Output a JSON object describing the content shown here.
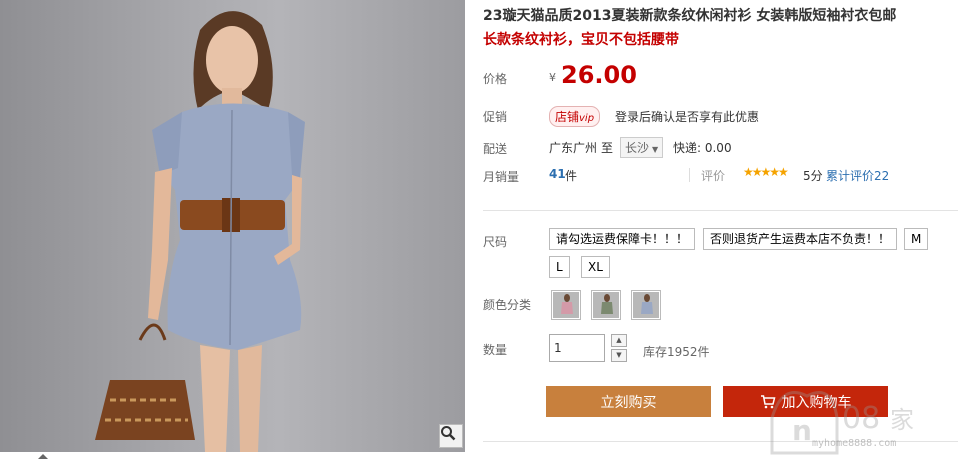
{
  "product": {
    "title_line1": "23璇天猫品质2013夏装新款条纹休闲衬衫 女装韩版短袖衬衣包邮",
    "title_line2": "长款条纹衬衫，宝贝不包括腰带"
  },
  "price": {
    "label": "价格",
    "symbol": "¥",
    "value": "26.00"
  },
  "promo": {
    "label": "促销",
    "tag": "店铺",
    "tag_vip": "vip",
    "text": "登录后确认是否享有此优惠"
  },
  "shipping": {
    "label": "配送",
    "from": "广东广州",
    "to_word": "至",
    "city": "长沙",
    "fee": "快递: 0.00"
  },
  "sales": {
    "label": "月销量",
    "count": "41",
    "unit": "件",
    "rating_label": "评价",
    "stars": "★★★★★",
    "score": "5分",
    "review_link": "累计评价22"
  },
  "size": {
    "label": "尺码",
    "options": [
      "请勾选运费保障卡！！！",
      "否则退货产生运费本店不负责！！",
      "M",
      "L",
      "XL"
    ]
  },
  "color": {
    "label": "颜色分类"
  },
  "quantity": {
    "label": "数量",
    "value": "1",
    "stock": "库存1952件"
  },
  "buttons": {
    "buy_now": "立刻购买",
    "add_cart": "加入购物车"
  },
  "watermark": {
    "text": "myhome8888.com"
  },
  "colors": {
    "price_red": "#c40000",
    "link_blue": "#2c6fb0",
    "buy_orange": "#c8803d",
    "cart_red": "#c4260b"
  }
}
